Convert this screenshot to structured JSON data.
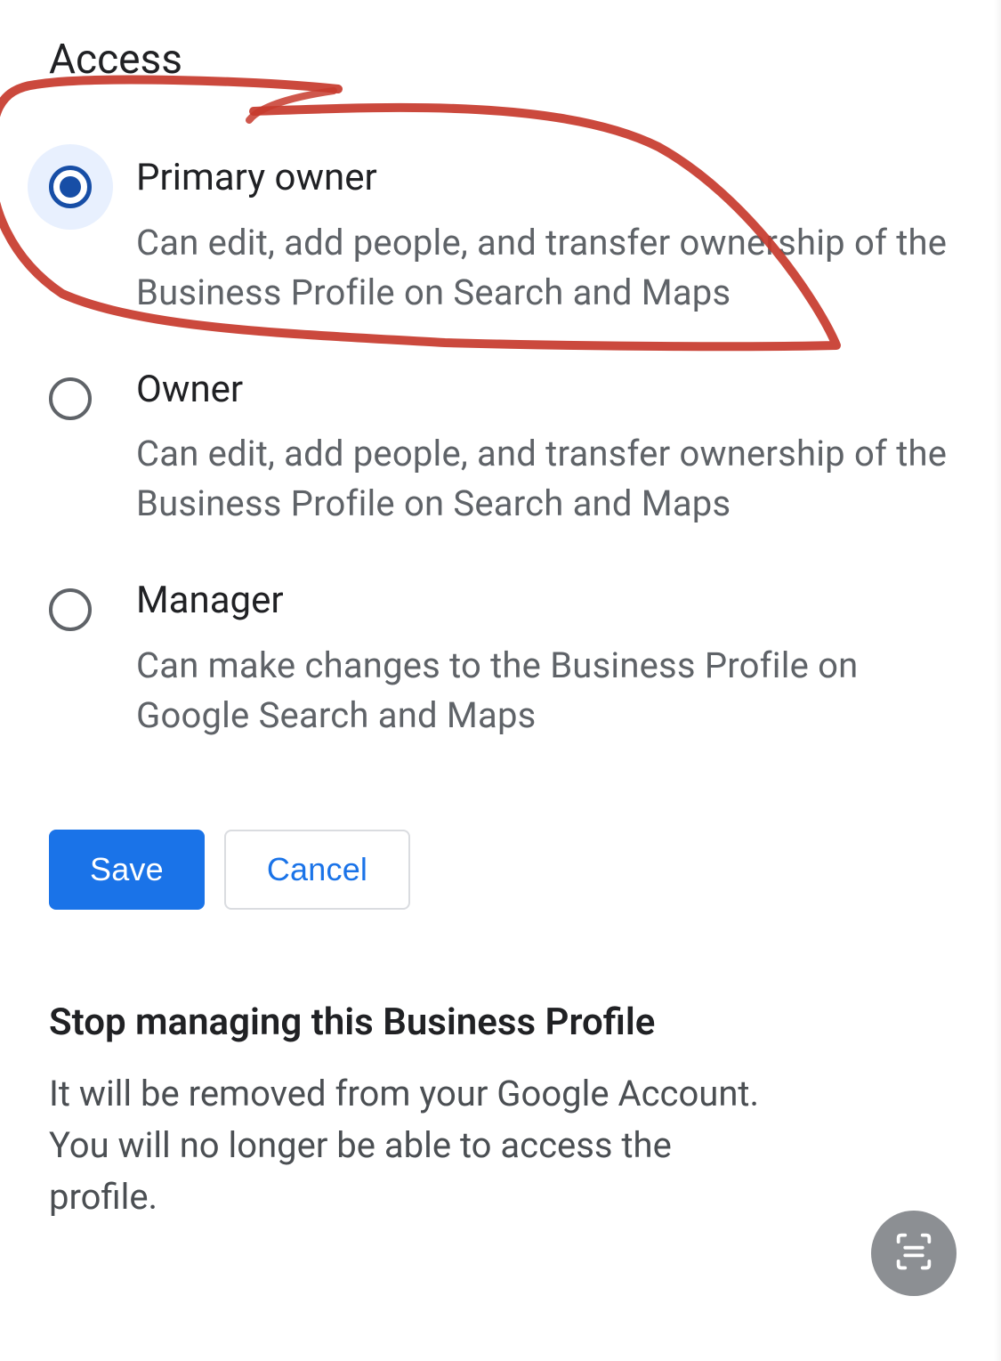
{
  "section": {
    "title": "Access"
  },
  "options": [
    {
      "title": "Primary owner",
      "description": "Can edit, add people, and transfer ownership of the Business Profile on Search and Maps",
      "selected": true
    },
    {
      "title": "Owner",
      "description": "Can edit, add people, and transfer ownership of the Business Profile on Search and Maps",
      "selected": false
    },
    {
      "title": "Manager",
      "description": "Can make changes to the Business Profile on Google Search and Maps",
      "selected": false
    }
  ],
  "buttons": {
    "save": "Save",
    "cancel": "Cancel"
  },
  "stop_managing": {
    "heading": "Stop managing this Business Profile",
    "body": "It will be removed from your Google Account. You will no longer be able to access the profile."
  },
  "colors": {
    "primary_blue": "#1a73e8",
    "radio_blue": "#174ea6",
    "halo_blue": "#e8f0fe",
    "text_primary": "#202124",
    "text_secondary": "#5f6368",
    "border_gray": "#dadce0",
    "fab_gray": "#8c8f93",
    "annotation_red": "#c7392d"
  }
}
